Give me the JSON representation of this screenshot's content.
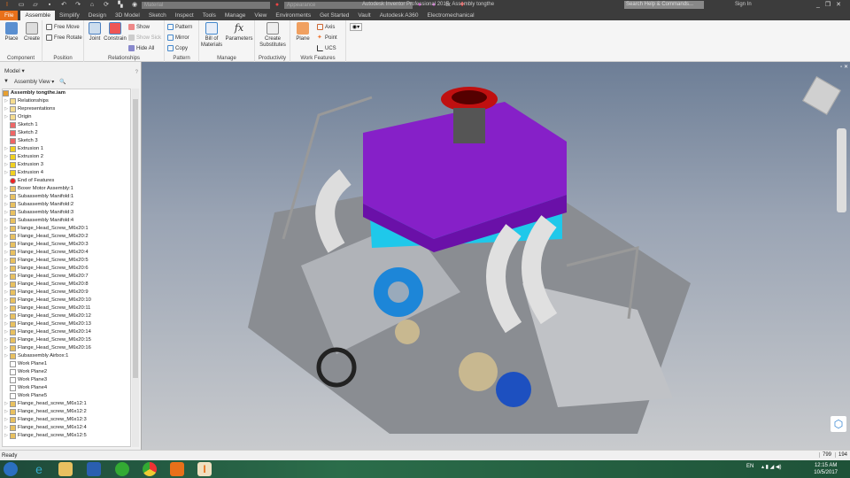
{
  "titlebar": {
    "title": "Autodesk Inventor Professional 2017",
    "document": "Assembly tongthe",
    "material": "Material",
    "appearance": "Appearance",
    "search_placeholder": "Search Help & Commands...",
    "sign_in": "Sign In"
  },
  "tabs": [
    "File",
    "Assemble",
    "Simplify",
    "Design",
    "3D Model",
    "Sketch",
    "Inspect",
    "Tools",
    "Manage",
    "View",
    "Environments",
    "Get Started",
    "Vault",
    "Autodesk A360",
    "Electromechanical"
  ],
  "ribbon": {
    "component": {
      "label": "Component",
      "place": "Place",
      "create": "Create"
    },
    "position": {
      "label": "Position",
      "free_move": "Free Move",
      "free_rotate": "Free Rotate"
    },
    "relationships": {
      "label": "Relationships",
      "joint": "Joint",
      "constrain": "Constrain",
      "show": "Show",
      "show_sick": "Show Sick",
      "hide_all": "Hide All"
    },
    "pattern": {
      "label": "Pattern",
      "pattern": "Pattern",
      "mirror": "Mirror",
      "copy": "Copy"
    },
    "manage": {
      "label": "Manage",
      "bom": "Bill of Materials",
      "parameters": "Parameters"
    },
    "productivity": {
      "label": "Productivity",
      "create_substitutes": "Create Substitutes"
    },
    "work_features": {
      "label": "Work Features",
      "plane": "Plane",
      "axis": "Axis",
      "point": "Point",
      "ucs": "UCS"
    }
  },
  "browser": {
    "title": "Model",
    "view": "Assembly View",
    "root": "Assembly tongthe.iam",
    "items": [
      "Relationships",
      "Representations",
      "Origin",
      "Sketch 1",
      "Sketch 2",
      "Sketch 3",
      "Extrusion 1",
      "Extrusion 2",
      "Extrusion 3",
      "Extrusion 4",
      "End of Features",
      "Boxer Motor Assembly:1",
      "Subassembly Manifold:1",
      "Subassembly Manifold:2",
      "Subassembly Manifold:3",
      "Subassembly Manifold:4",
      "Flange_Head_Screw_M6x20:1",
      "Flange_Head_Screw_M6x20:2",
      "Flange_Head_Screw_M6x20:3",
      "Flange_Head_Screw_M6x20:4",
      "Flange_Head_Screw_M6x20:5",
      "Flange_Head_Screw_M6x20:6",
      "Flange_Head_Screw_M6x20:7",
      "Flange_Head_Screw_M6x20:8",
      "Flange_Head_Screw_M6x20:9",
      "Flange_Head_Screw_M6x20:10",
      "Flange_Head_Screw_M6x20:11",
      "Flange_Head_Screw_M6x20:12",
      "Flange_Head_Screw_M6x20:13",
      "Flange_Head_Screw_M6x20:14",
      "Flange_Head_Screw_M6x20:15",
      "Flange_Head_Screw_M6x20:16",
      "Subassembly Airbox:1",
      "Work Plane1",
      "Work Plane2",
      "Work Plane3",
      "Work Plane4",
      "Work Plane5",
      "Flange_head_screw_M6x12:1",
      "Flange_head_screw_M6x12:2",
      "Flange_head_screw_M6x12:3",
      "Flange_head_screw_M6x12:4",
      "Flange_head_screw_M6x12:5"
    ]
  },
  "status": {
    "text": "Ready",
    "x": "799",
    "y": "194"
  },
  "taskbar": {
    "lang": "EN",
    "time": "12:15 AM",
    "date": "10/5/2017"
  },
  "colors": {
    "file_tab": "#e8701a",
    "airbox": "#8a1fc9",
    "block": "#1ec8e8"
  }
}
